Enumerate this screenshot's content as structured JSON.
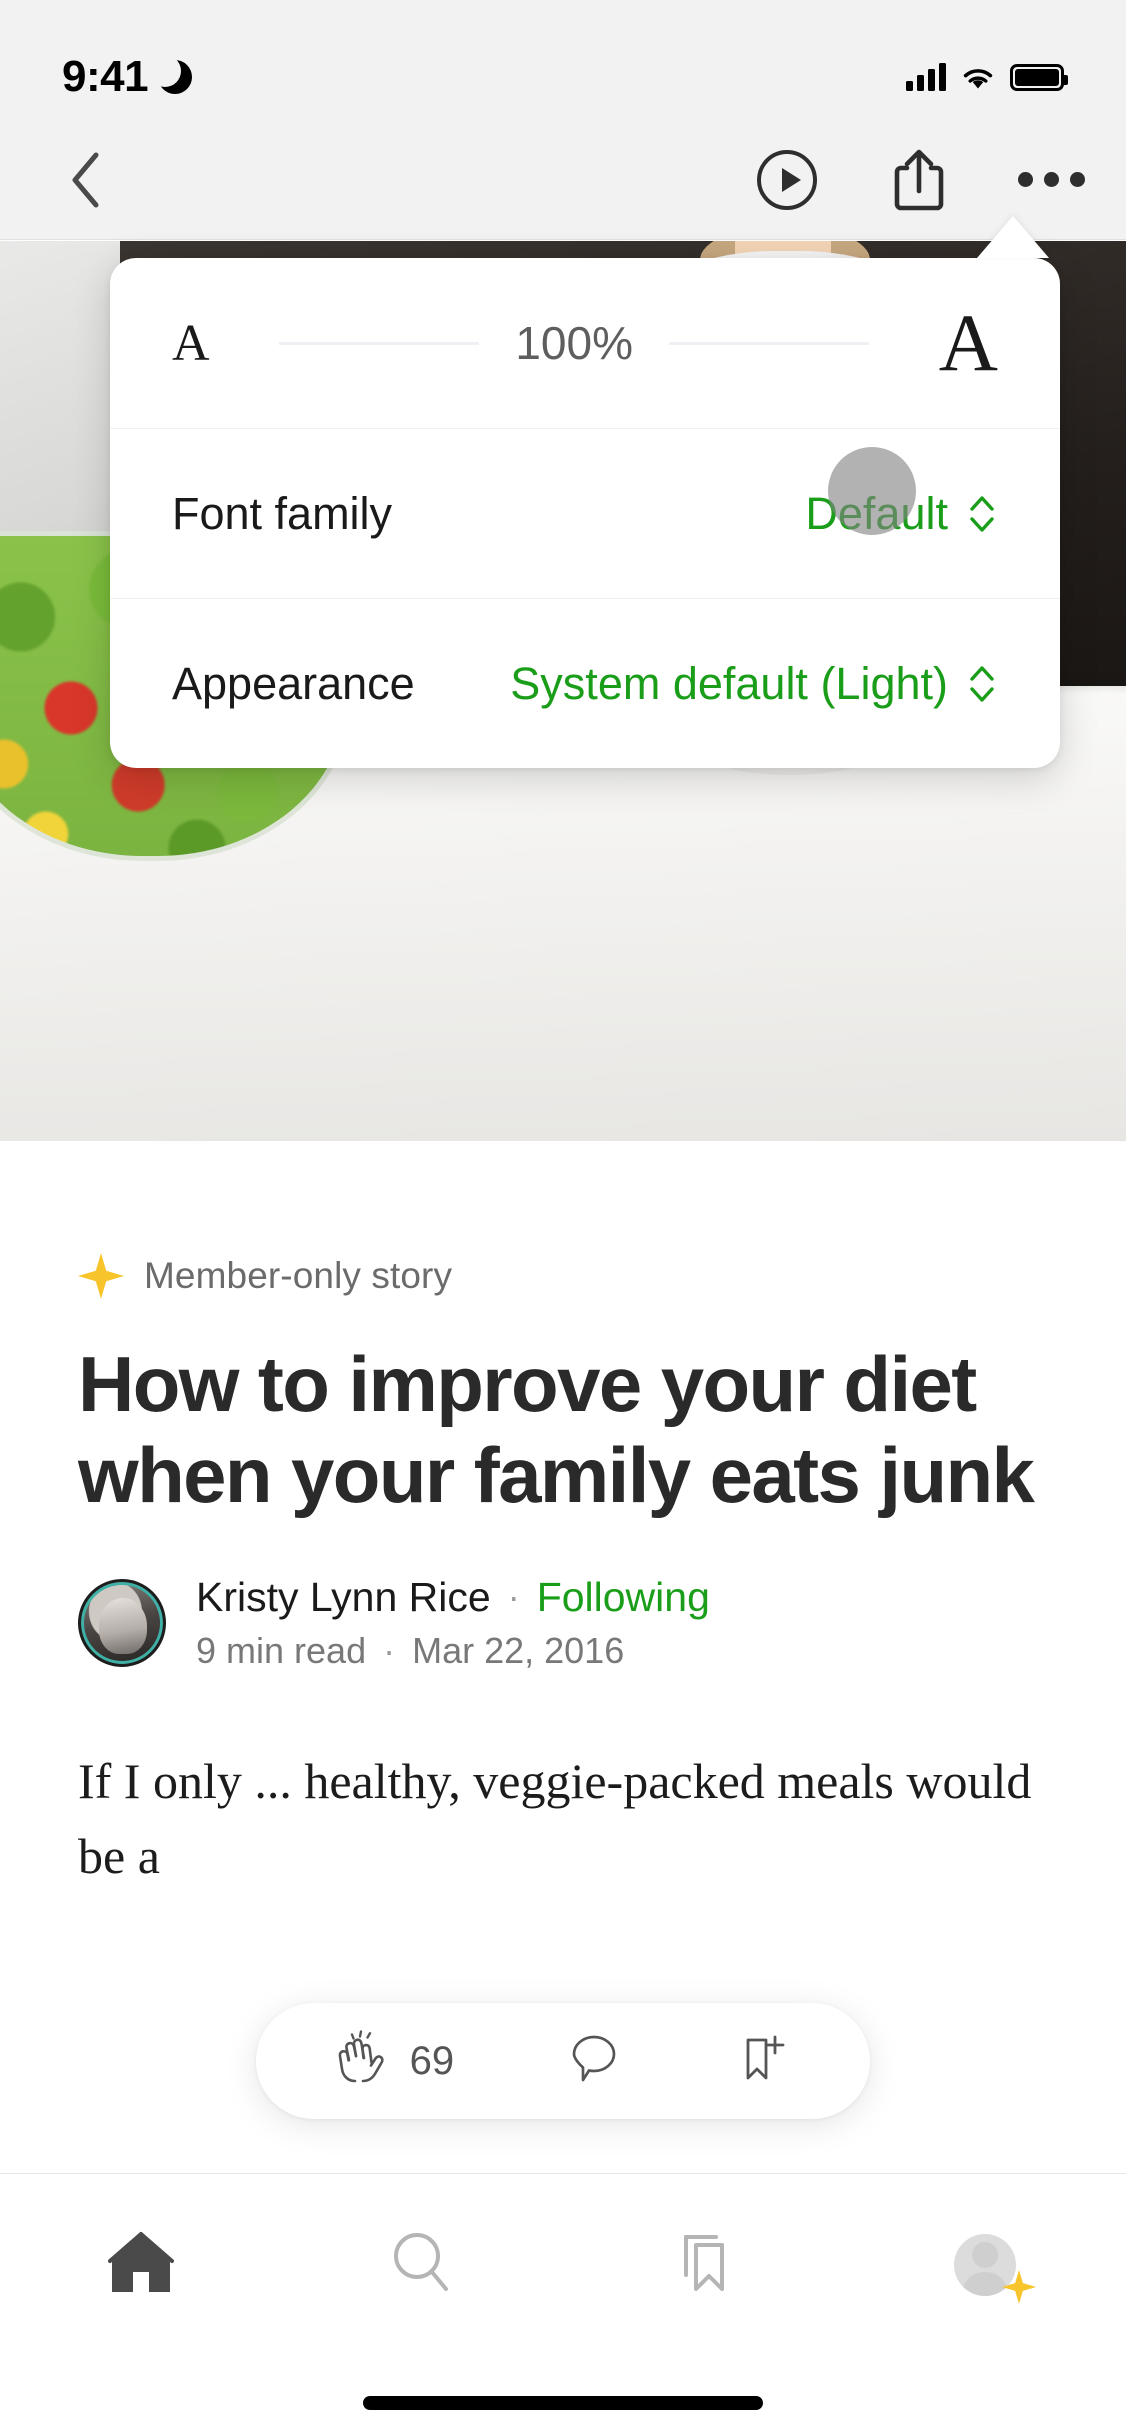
{
  "status_bar": {
    "time": "9:41",
    "moon_icon": "crescent-moon-icon",
    "cellular_icon": "cellular-bars-icon",
    "wifi_icon": "wifi-icon",
    "battery_icon": "battery-full-icon"
  },
  "nav_bar": {
    "back_icon": "chevron-left-icon",
    "listen_icon": "play-circle-icon",
    "share_icon": "share-up-icon",
    "more_icon": "more-horizontal-icon"
  },
  "popover": {
    "zoom_row": {
      "decrease_label": "A",
      "increase_label": "A",
      "value": "100%"
    },
    "font_family": {
      "label": "Font family",
      "value": "Default",
      "chevron_icon": "chevron-up-down-icon"
    },
    "appearance": {
      "label": "Appearance",
      "value": "System default (Light)",
      "chevron_icon": "chevron-up-down-icon"
    },
    "touch_indicator": "touch-point-indicator"
  },
  "article": {
    "badge": {
      "icon": "star-icon",
      "label": "Member-only story"
    },
    "title": "How to improve your diet when your family eats junk",
    "author": {
      "name": "Kristy Lynn Rice",
      "separator": "·",
      "follow_state": "Following",
      "read_time": "9  min read",
      "date": "Mar 22, 2016",
      "avatar": "author-avatar"
    },
    "body_paragraph": "If I only ... healthy, veggie-packed meals would be a"
  },
  "action_bar": {
    "clap_icon": "clap-icon",
    "clap_count": "69",
    "comment_icon": "comment-bubble-icon",
    "bookmark_icon": "bookmark-add-icon"
  },
  "tab_bar": {
    "items": [
      {
        "name": "home",
        "icon": "home-icon",
        "active": true
      },
      {
        "name": "search",
        "icon": "search-icon",
        "active": false
      },
      {
        "name": "library",
        "icon": "bookmark-icon",
        "active": false
      },
      {
        "name": "profile",
        "icon": "avatar-icon",
        "active": false
      }
    ],
    "home_indicator": "home-indicator"
  },
  "colors": {
    "accent_green": "#1a9e1a",
    "star_gold": "#f7c52b",
    "chrome_grey": "#f2f2f2",
    "text_primary": "#1a1a1a",
    "text_secondary": "#787878"
  }
}
